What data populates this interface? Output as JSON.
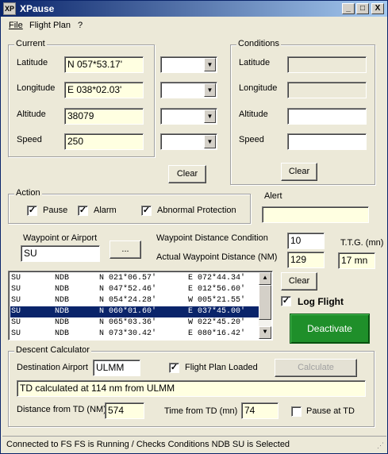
{
  "window": {
    "title": "XPause",
    "icon_text": "XP",
    "min": "_",
    "max": "□",
    "close": "X"
  },
  "menu": {
    "file": "File",
    "flight_plan": "Flight Plan",
    "help": "?"
  },
  "current": {
    "label": "Current",
    "latitude_label": "Latitude",
    "latitude": "N 057*53.17'",
    "longitude_label": "Longitude",
    "longitude": "E 038*02.03'",
    "altitude_label": "Altitude",
    "altitude": "38079",
    "speed_label": "Speed",
    "speed": "250",
    "clear": "Clear"
  },
  "conditions": {
    "label": "Conditions",
    "latitude_label": "Latitude",
    "longitude_label": "Longitude",
    "altitude_label": "Altitude",
    "speed_label": "Speed",
    "latitude": "",
    "longitude": "",
    "altitude": "",
    "speed": "",
    "clear": "Clear"
  },
  "action": {
    "label": "Action",
    "pause": "Pause",
    "alarm": "Alarm",
    "abnormal": "Abnormal Protection",
    "pause_checked": "✓",
    "alarm_checked": "✓",
    "abnormal_checked": "✓"
  },
  "alert": {
    "label": "Alert",
    "value": ""
  },
  "waypoint": {
    "label": "Waypoint or Airport",
    "value": "SU",
    "browse": "...",
    "dist_cond_label": "Waypoint Distance Condition",
    "dist_cond": "10",
    "actual_label": "Actual Waypoint Distance (NM)",
    "actual": "129",
    "ttg_label": "T.T.G. (mn)",
    "ttg": "17 mn",
    "clear": "Clear"
  },
  "list": [
    {
      "id": "SU",
      "type": "NDB",
      "lat": "N 021*06.57'",
      "lon": "E 072*44.34'",
      "selected": false
    },
    {
      "id": "SU",
      "type": "NDB",
      "lat": "N 047*52.46'",
      "lon": "E 012*56.60'",
      "selected": false
    },
    {
      "id": "SU",
      "type": "NDB",
      "lat": "N 054*24.28'",
      "lon": "W 005*21.55'",
      "selected": false
    },
    {
      "id": "SU",
      "type": "NDB",
      "lat": "N 060*01.60'",
      "lon": "E 037*45.00'",
      "selected": true
    },
    {
      "id": "SU",
      "type": "NDB",
      "lat": "N 065*03.36'",
      "lon": "W 022*45.20'",
      "selected": false
    },
    {
      "id": "SU",
      "type": "NDB",
      "lat": "N 073*30.42'",
      "lon": "E 080*16.42'",
      "selected": false
    }
  ],
  "log_flight": {
    "label": "Log Flight",
    "checked": "✓"
  },
  "deactivate": "Deactivate",
  "descent": {
    "label": "Descent Calculator",
    "dest_label": "Destination Airport",
    "dest": "ULMM",
    "fp_loaded_label": "Flight Plan Loaded",
    "fp_checked": "✓",
    "calculate": "Calculate",
    "message": "TD calculated at 114 nm from ULMM",
    "dist_label": "Distance from TD (NM)",
    "dist": "574",
    "time_label": "Time from TD (mn)",
    "time": "74",
    "pause_td_label": "Pause at TD",
    "pause_td_checked": ""
  },
  "status": "Connected to FS  FS is Running / Checks Conditions  NDB SU is Selected",
  "colors": {
    "title_start": "#0a246a",
    "selected_row": "#0a246a",
    "deactivate": "#1f8f2a",
    "input_yellow": "#ffffe1"
  }
}
